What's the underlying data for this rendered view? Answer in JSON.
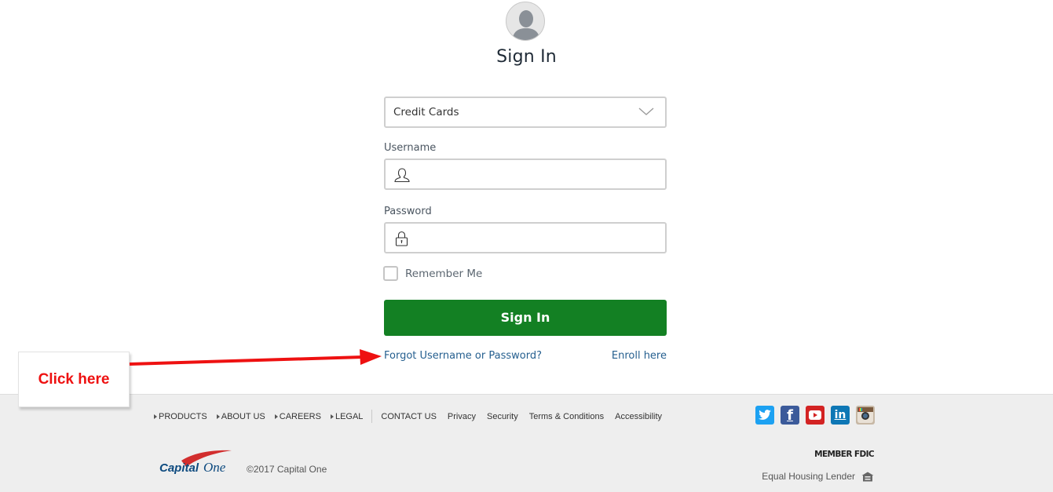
{
  "signin": {
    "title": "Sign In",
    "account_type": {
      "selected": "Credit Cards"
    },
    "username": {
      "label": "Username",
      "value": "",
      "icon": "user-icon"
    },
    "password": {
      "label": "Password",
      "value": "",
      "icon": "lock-icon"
    },
    "remember_me": {
      "label": "Remember Me",
      "checked": false
    },
    "submit_label": "Sign In",
    "forgot_link": "Forgot Username or Password?",
    "enroll_link": "Enroll here",
    "accent_color": "#138023",
    "link_color": "#255f8f"
  },
  "annotation": {
    "callout_text": "Click here",
    "color": "#ee1111"
  },
  "footer": {
    "nav_expandable": [
      "PRODUCTS",
      "ABOUT US",
      "CAREERS",
      "LEGAL"
    ],
    "nav_links": [
      "CONTACT US",
      "Privacy",
      "Security",
      "Terms & Conditions",
      "Accessibility"
    ],
    "social": [
      "twitter-icon",
      "facebook-icon",
      "youtube-icon",
      "linkedin-icon",
      "instagram-icon"
    ],
    "logo_text": "Capital One",
    "copyright": "©2017 Capital One",
    "fdic": "MEMBER FDIC",
    "equal_housing": "Equal Housing Lender"
  }
}
